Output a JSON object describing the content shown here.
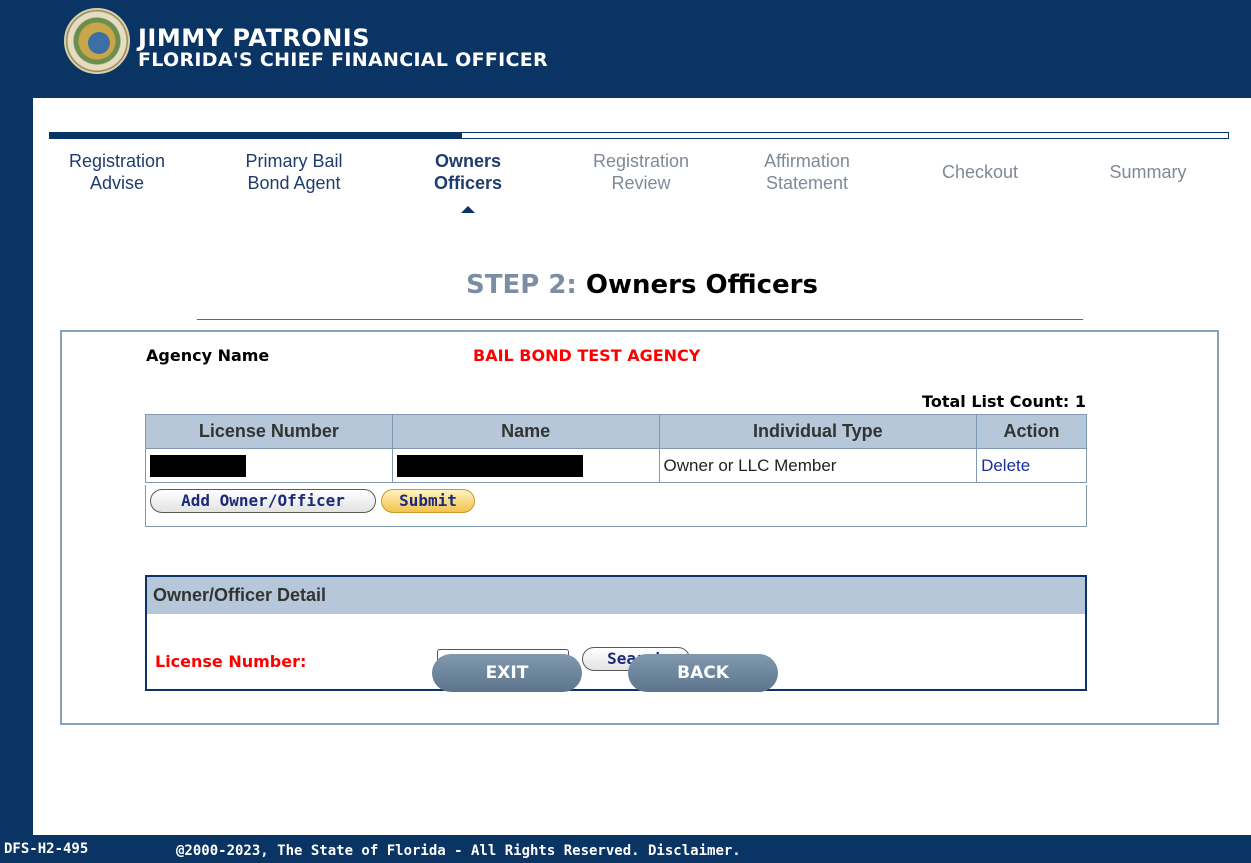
{
  "header": {
    "name": "JIMMY PATRONIS",
    "subtitle": "FLORIDA'S CHIEF FINANCIAL OFFICER",
    "seal_icon": "state-seal-icon"
  },
  "steps": [
    {
      "label": "Registration\nAdvise",
      "state": "done"
    },
    {
      "label": "Primary Bail\nBond Agent",
      "state": "done"
    },
    {
      "label": "Owners\nOfficers",
      "state": "active"
    },
    {
      "label": "Registration\nReview",
      "state": "pending"
    },
    {
      "label": "Affirmation\nStatement",
      "state": "pending"
    },
    {
      "label": "Checkout",
      "state": "pending"
    },
    {
      "label": "Summary",
      "state": "pending"
    }
  ],
  "page": {
    "step_label": "STEP 2:",
    "step_title": "Owners Officers"
  },
  "agency": {
    "label": "Agency Name",
    "value": "BAIL BOND TEST AGENCY"
  },
  "list": {
    "count_text": "Total List Count: 1",
    "columns": [
      "License Number",
      "Name",
      "Individual Type",
      "Action"
    ],
    "rows": [
      {
        "license": "",
        "name": "",
        "type": "Owner or LLC Member",
        "action": "Delete"
      }
    ],
    "add_button": "Add Owner/Officer",
    "submit_button": "Submit"
  },
  "detail": {
    "title": "Owner/Officer Detail",
    "license_label": "License Number:",
    "license_value": "",
    "search_button": "Search"
  },
  "nav": {
    "exit": "EXIT",
    "back": "BACK"
  },
  "footer": {
    "code": "DFS-H2-495",
    "copyright": "@2000-2023, The State of Florida - All Rights Reserved. Disclaimer."
  },
  "colors": {
    "brand_navy": "#0a3463",
    "table_header": "#b5c7d8",
    "alert_red": "#ff0000",
    "submit_gold": "#f3c24e"
  }
}
